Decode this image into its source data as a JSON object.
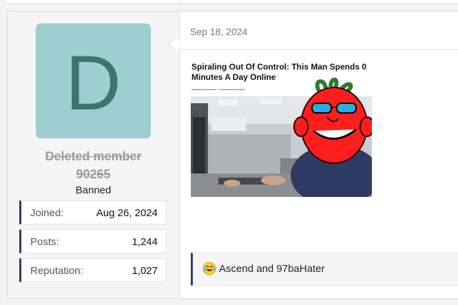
{
  "post": {
    "date": "Sep 18, 2024",
    "author": {
      "avatar_letter": "D",
      "avatar_color": "#9ecfd0",
      "name_line1": "Deleted member",
      "name_line2": "90265",
      "user_title": "Banned"
    },
    "stats": [
      {
        "label": "Joined:",
        "value": "Aug 26, 2024"
      },
      {
        "label": "Posts:",
        "value": "1,244"
      },
      {
        "label": "Reputation:",
        "value": "1,027"
      }
    ],
    "image": {
      "headline": "Spiraling Out Of Control: This Man Spends   0 Minutes A Day Online"
    },
    "reactions": {
      "icon": "tears-of-joy-emoji-icon",
      "text": "Ascend and 97baHater"
    }
  },
  "colors": {
    "accent": "#2c3a6b",
    "username": "#9a9a9a",
    "avatar_letter": "#3c7472"
  }
}
